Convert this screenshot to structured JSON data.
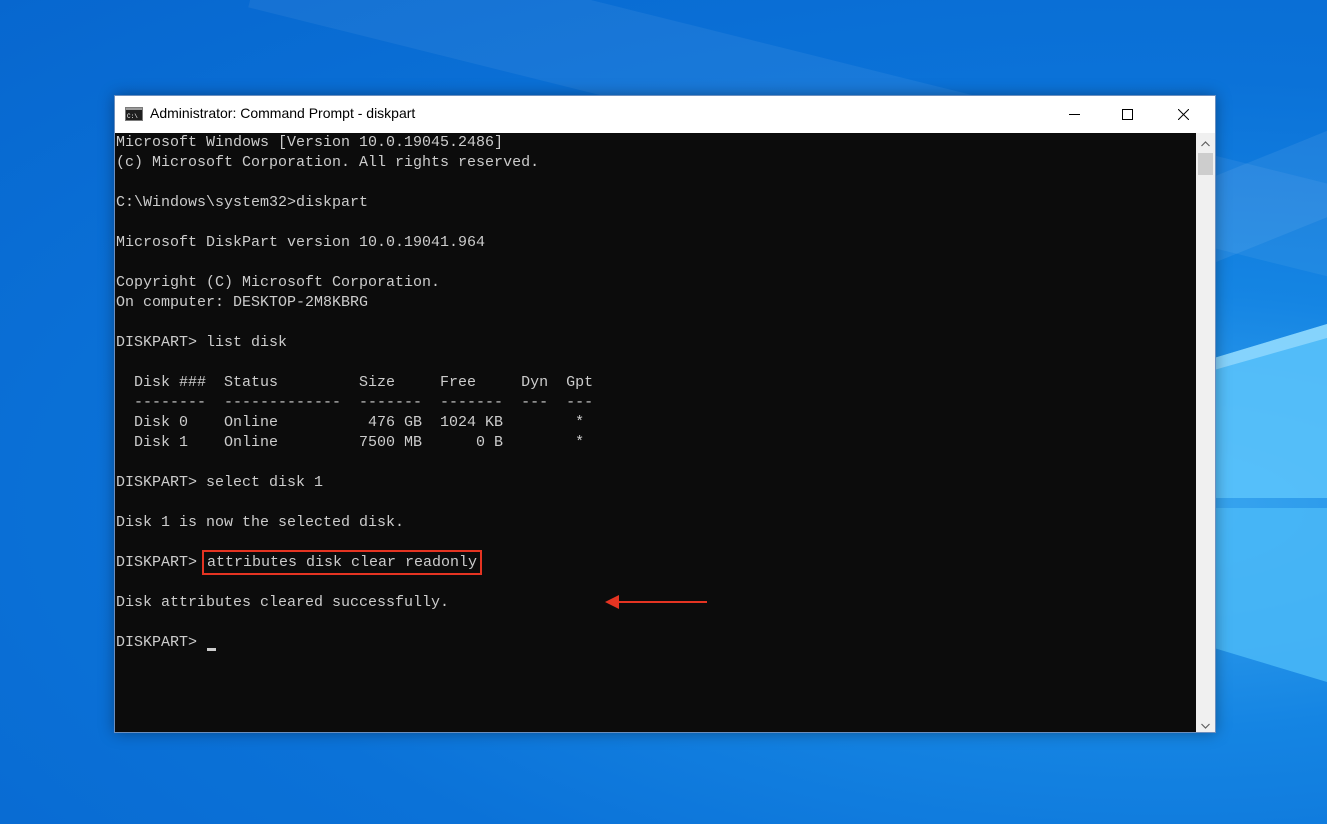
{
  "window": {
    "title": "Administrator: Command Prompt - diskpart",
    "app_icon": "cmd-icon",
    "controls": {
      "minimize_icon": "minimize-icon",
      "maximize_icon": "maximize-icon",
      "close_icon": "close-icon"
    }
  },
  "console": {
    "lines": [
      "Microsoft Windows [Version 10.0.19045.2486]",
      "(c) Microsoft Corporation. All rights reserved.",
      "",
      "C:\\Windows\\system32>diskpart",
      "",
      "Microsoft DiskPart version 10.0.19041.964",
      "",
      "Copyright (C) Microsoft Corporation.",
      "On computer: DESKTOP-2M8KBRG",
      "",
      "DISKPART> list disk",
      "",
      "  Disk ###  Status         Size     Free     Dyn  Gpt",
      "  --------  -------------  -------  -------  ---  ---",
      "  Disk 0    Online          476 GB  1024 KB        *",
      "  Disk 1    Online         7500 MB      0 B        *",
      "",
      "DISKPART> select disk 1",
      "",
      "Disk 1 is now the selected disk.",
      "",
      "",
      "",
      "Disk attributes cleared successfully.",
      ""
    ],
    "highlighted_prompt": "DISKPART> ",
    "highlighted_command": "attributes disk clear readonly",
    "final_prompt": "DISKPART> "
  },
  "colors": {
    "console_background": "#0c0c0c",
    "console_text": "#cccccc",
    "highlight_box": "#e53422",
    "desktop_background": "#0b72d8"
  }
}
